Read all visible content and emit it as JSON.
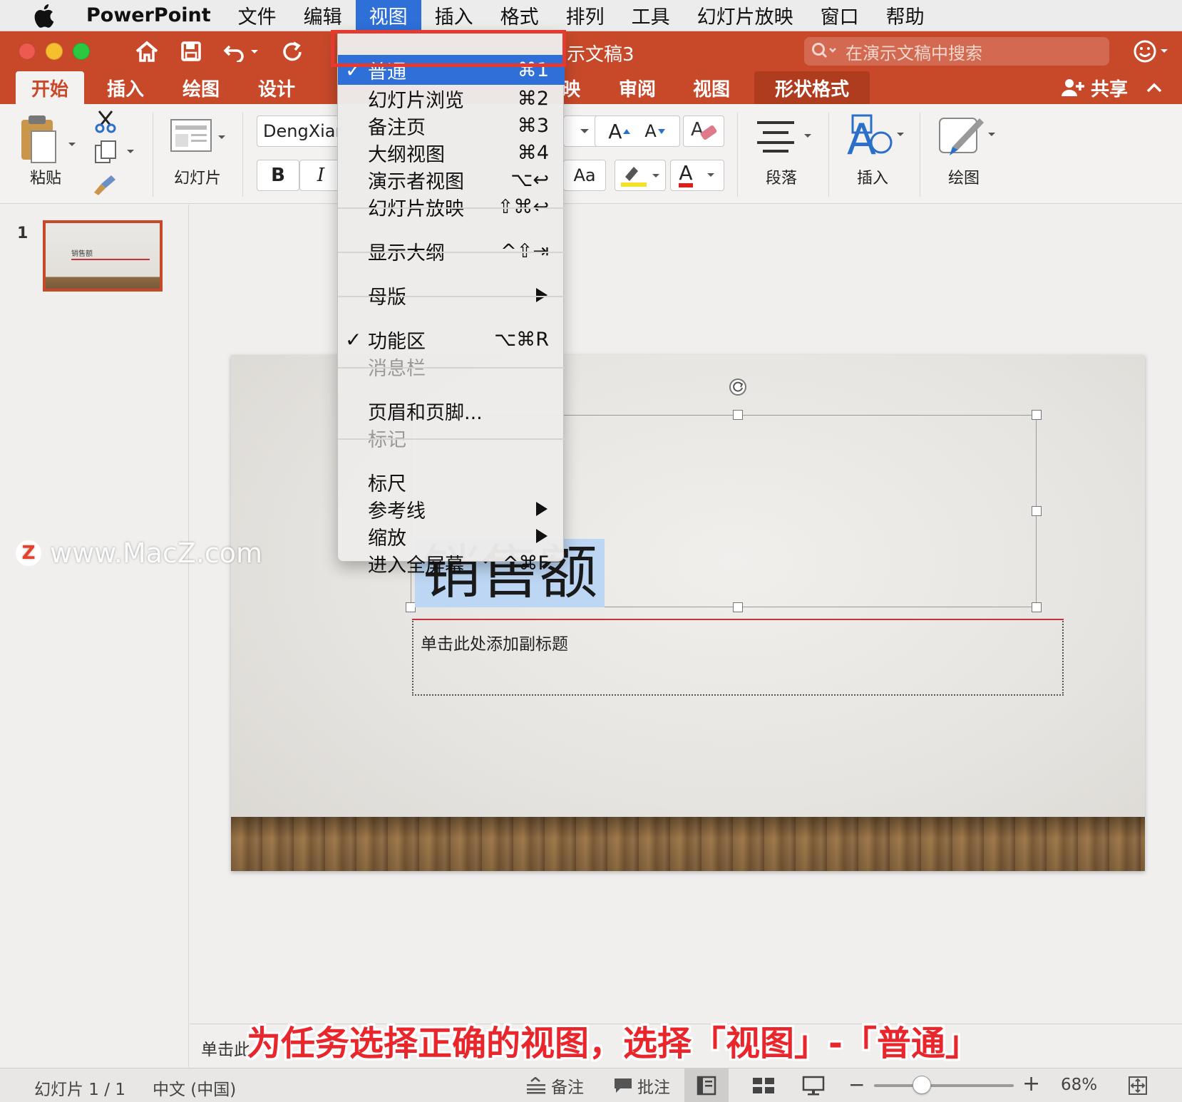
{
  "menubar": {
    "app_name": "PowerPoint",
    "items": [
      "文件",
      "编辑",
      "视图",
      "插入",
      "格式",
      "排列",
      "工具",
      "幻灯片放映",
      "窗口",
      "帮助"
    ],
    "active_item": "视图"
  },
  "titlebar": {
    "doc_title": "示文稿3",
    "search_placeholder": "在演示文稿中搜索"
  },
  "ribbon_tabs": {
    "items": [
      "开始",
      "插入",
      "绘图",
      "设计",
      "映",
      "审阅",
      "视图",
      "形状格式"
    ],
    "selected": "开始",
    "share_label": "共享"
  },
  "ribbon": {
    "paste_label": "粘贴",
    "slide_label": "幻灯片",
    "font_name": "DengXian",
    "bold": "B",
    "italic": "I",
    "grow_font": "A",
    "shrink_font": "A",
    "change_case": "Aa",
    "font_color_letter": "A",
    "paragraph_label": "段落",
    "insert_label": "插入",
    "drawing_label": "绘图"
  },
  "view_menu": {
    "items": [
      {
        "label": "普通",
        "shortcut": "⌘1",
        "checked": true,
        "highlighted": true
      },
      {
        "label": "幻灯片浏览",
        "shortcut": "⌘2"
      },
      {
        "label": "备注页",
        "shortcut": "⌘3"
      },
      {
        "label": "大纲视图",
        "shortcut": "⌘4"
      },
      {
        "label": "演示者视图",
        "shortcut": "⌥↩"
      },
      {
        "label": "幻灯片放映",
        "shortcut": "⇧⌘↩"
      },
      {
        "label": "显示大纲",
        "shortcut": "^⇧⇥"
      },
      {
        "label": "母版",
        "submenu": true
      },
      {
        "label": "功能区",
        "shortcut": "⌥⌘R",
        "checked": true
      },
      {
        "label": "消息栏",
        "disabled": true
      },
      {
        "label": "页眉和页脚...",
        "shortcut": ""
      },
      {
        "label": "标记",
        "disabled": true
      },
      {
        "label": "标尺",
        "shortcut": ""
      },
      {
        "label": "参考线",
        "submenu": true
      },
      {
        "label": "缩放",
        "submenu": true
      },
      {
        "label": "进入全屏幕",
        "shortcut": "^⌘F"
      }
    ]
  },
  "slides_pane": {
    "slide_number": "1",
    "thumb_title": "销售额"
  },
  "slide": {
    "title": "销售额",
    "subtitle_placeholder": "单击此处添加副标题"
  },
  "notes": {
    "placeholder": "单击此"
  },
  "statusbar": {
    "slide_info": "幻灯片 1 / 1",
    "language": "中文 (中国)",
    "notes_label": "备注",
    "comments_label": "批注",
    "zoom": "68%",
    "zoom_minus": "−",
    "zoom_plus": "+"
  },
  "watermark": {
    "logo": "Z",
    "text": "www.MacZ.com"
  },
  "caption": "为任务选择正确的视图，选择「视图」-「普通」"
}
